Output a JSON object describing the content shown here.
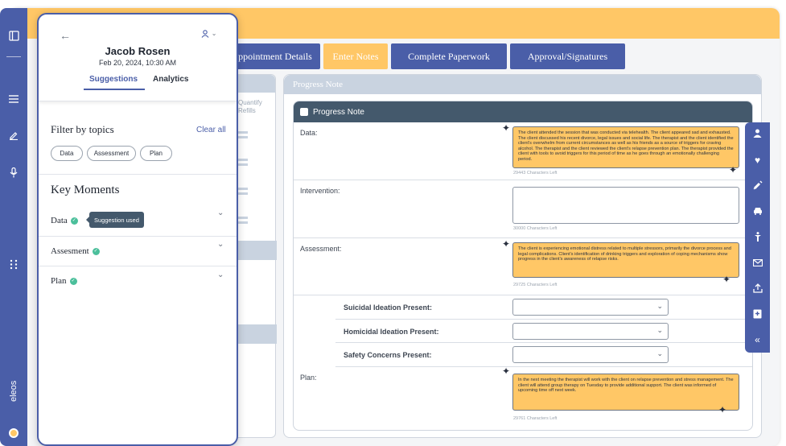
{
  "app": {
    "brand": "eleos"
  },
  "tabs": [
    {
      "label": "Appointment Details",
      "visible_label": "ppointment Details"
    },
    {
      "label": "Enter Notes"
    },
    {
      "label": "Complete Paperwork"
    },
    {
      "label": "Approval/Signatures"
    }
  ],
  "background_list": {
    "column_header": "Quantify Refills"
  },
  "progress_note": {
    "section_title": "Progress Note",
    "checkbox_label": "Progress Note",
    "data": {
      "label": "Data:",
      "text": "The client attended the session that was conducted via telehealth. The client appeared sad and exhausted. The client discussed his recent divorce, legal issues and social life. The therapist and the client identified the client's overwhelm from current circumstances as well as his friends as a source of triggers for craving alcohol. The therapist and the client reviewed the client's relapse prevention plan. The therapist provided the client with tools to avoid triggers for this period of time as he goes through an emotionally challenging period.",
      "chars_left": "29443 Characters Left"
    },
    "intervention": {
      "label": "Intervention:",
      "text": "",
      "chars_left": "30000 Characters Left"
    },
    "assessment": {
      "label": "Assessment:",
      "text": "The client is experiencing emotional distress related to multiple stressors, primarily the divorce process and legal complications. Client's identification of drinking triggers and exploration of coping mechanisms show progress in the client's awareness of relapse risks.",
      "chars_left": "29725 Characters Left"
    },
    "suicidal": {
      "label": "Suicidal Ideation Present:",
      "value": ""
    },
    "homicidal": {
      "label": "Homicidal Ideation Present:",
      "value": ""
    },
    "safety": {
      "label": "Safety Concerns Present:",
      "value": ""
    },
    "plan": {
      "label": "Plan:",
      "text": "In the next meeting the therapist will work with the client on relapse prevention and stress management. The client will attend group therapy on Tuesday to provide additional support. The client was informed of upcoming time off next week.",
      "chars_left": "29761 Characters Left"
    }
  },
  "panel": {
    "client_name": "Jacob Rosen",
    "session_date": "Feb 20, 2024, 10:30 AM",
    "tabs": {
      "suggestions": "Suggestions",
      "analytics": "Analytics"
    },
    "filter": {
      "title": "Filter by topics",
      "clear_all": "Clear all",
      "chips": [
        "Data",
        "Assessment",
        "Plan"
      ]
    },
    "key_moments": {
      "title": "Key Moments",
      "items": [
        {
          "label": "Data"
        },
        {
          "label": "Assesment"
        },
        {
          "label": "Plan"
        }
      ],
      "tooltip": "Suggestion used"
    }
  },
  "colors": {
    "accent": "#4a5ea8",
    "highlight": "#ffc766",
    "dark_bar": "#44596c",
    "success": "#4bbf9b"
  }
}
